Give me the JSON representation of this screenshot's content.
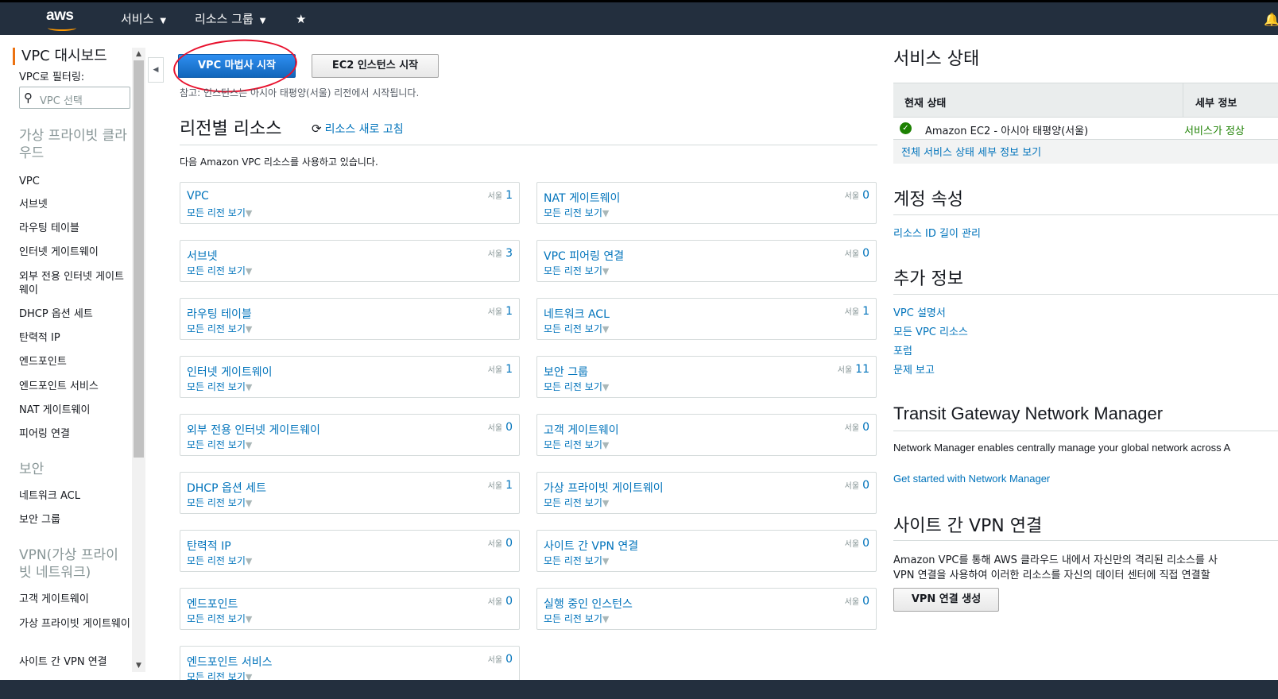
{
  "topnav": {
    "logo": "aws",
    "services_label": "서비스",
    "resource_groups_label": "리소스 그룹"
  },
  "sidebar": {
    "title": "VPC 대시보드",
    "filter_label": "VPC로 필터링:",
    "search_placeholder": "VPC 선택",
    "sections": [
      {
        "label": "가상 프라이빗 클라우드"
      },
      {
        "label": "보안"
      },
      {
        "label": "VPN(가상 프라이빗 네트워크)"
      }
    ],
    "items": [
      "VPC",
      "서브넷",
      "라우팅 테이블",
      "인터넷 게이트웨이",
      "외부 전용 인터넷 게이트웨이",
      "DHCP 옵션 세트",
      "탄력적 IP",
      "엔드포인트",
      "엔드포인트 서비스",
      "NAT 게이트웨이",
      "피어링 연결",
      "네트워크 ACL",
      "보안 그룹",
      "고객 게이트웨이",
      "가상 프라이빗 게이트웨이",
      "사이트 간 VPN 연결"
    ]
  },
  "main": {
    "launch_wizard_label": "VPC 마법사 시작",
    "launch_ec2_label": "EC2 인스턴스 시작",
    "note": "참고: 인스턴스는 아시아 태평양(서울) 리전에서 시작됩니다.",
    "resources_title": "리전별 리소스",
    "refresh_label": "리소스 새로 고침",
    "using_text": "다음 Amazon VPC 리소스를 사용하고 있습니다.",
    "all_regions_label": "모든 리전 보기",
    "region_short": "서울",
    "cards": [
      {
        "name": "VPC",
        "count": "1"
      },
      {
        "name": "NAT 게이트웨이",
        "count": "0"
      },
      {
        "name": "서브넷",
        "count": "3"
      },
      {
        "name": "VPC 피어링 연결",
        "count": "0"
      },
      {
        "name": "라우팅 테이블",
        "count": "1"
      },
      {
        "name": "네트워크 ACL",
        "count": "1"
      },
      {
        "name": "인터넷 게이트웨이",
        "count": "1"
      },
      {
        "name": "보안 그룹",
        "count": "11"
      },
      {
        "name": "외부 전용 인터넷 게이트웨이",
        "count": "0"
      },
      {
        "name": "고객 게이트웨이",
        "count": "0"
      },
      {
        "name": "DHCP 옵션 세트",
        "count": "1"
      },
      {
        "name": "가상 프라이빗 게이트웨이",
        "count": "0"
      },
      {
        "name": "탄력적 IP",
        "count": "0"
      },
      {
        "name": "사이트 간 VPN 연결",
        "count": "0"
      },
      {
        "name": "엔드포인트",
        "count": "0"
      },
      {
        "name": "실행 중인 인스턴스",
        "count": "0"
      },
      {
        "name": "엔드포인트 서비스",
        "count": "0"
      }
    ]
  },
  "right": {
    "service_status_title": "서비스 상태",
    "current_status_header": "현재 상태",
    "details_header": "세부 정보",
    "status_row_name": "Amazon EC2 - 아시아 태평양(서울)",
    "status_row_status": "서비스가 정상",
    "status_detail_link": "전체 서비스 상태 세부 정보 보기",
    "account_title": "계정 속성",
    "resource_id_link": "리소스 ID 길이 관리",
    "extra_title": "추가 정보",
    "extra_links": [
      "VPC 설명서",
      "모든 VPC 리소스",
      "포럼",
      "문제 보고"
    ],
    "tgnm_title": "Transit Gateway Network Manager",
    "tgnm_text": "Network Manager enables centrally manage your global network across A",
    "tgnm_link": "Get started with Network Manager",
    "vpn_title": "사이트 간 VPN 연결",
    "vpn_text1": "Amazon VPC를 통해 AWS 클라우드 내에서 자신만의 격리된 리소스를 사",
    "vpn_text2": "VPN 연결을 사용하여 이러한 리소스를 자신의 데이터 센터에 직접 연결할",
    "vpn_button_label": "VPN 연결 생성"
  }
}
